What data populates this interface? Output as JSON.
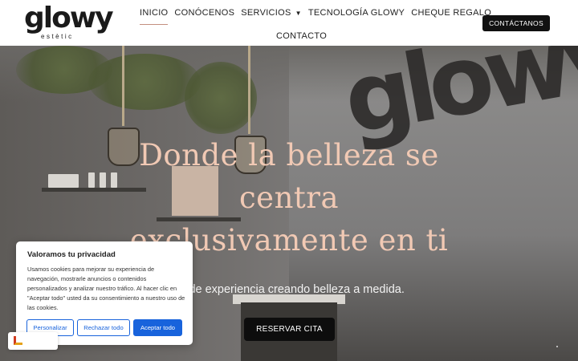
{
  "header": {
    "logo": {
      "word": "glowy",
      "sub": "estètic"
    },
    "nav": [
      {
        "label": "INICIO",
        "active": true
      },
      {
        "label": "CONÓCENOS"
      },
      {
        "label": "SERVICIOS",
        "has_dropdown": true,
        "icon": "chevron-down-icon"
      },
      {
        "label": "TECNOLOGÍA GLOWY"
      },
      {
        "label": "CHEQUE REGALO"
      },
      {
        "label": "CONTACTO"
      }
    ],
    "cta_label": "CONTÁCTANOS"
  },
  "hero": {
    "title": "Donde la belleza se centra exclusivamente en ti",
    "subtitle": "os de experiencia creando belleza a medida.",
    "button_label": "RESERVAR CITA",
    "wall_sign": "glowy"
  },
  "cookie_banner": {
    "title": "Valoramos tu privacidad",
    "text": "Usamos cookies para mejorar su experiencia de navegación, mostrarle anuncios o contenidos personalizados y analizar nuestro tráfico. Al hacer clic en \"Aceptar todo\" usted da su consentimiento a nuestro uso de las cookies.",
    "buttons": {
      "customize": "Personalizar",
      "reject": "Rechazar todo",
      "accept": "Aceptar todo"
    }
  },
  "colors": {
    "accent": "#f1c9b4",
    "primary_button": "#1863dc",
    "dark": "#111111"
  }
}
